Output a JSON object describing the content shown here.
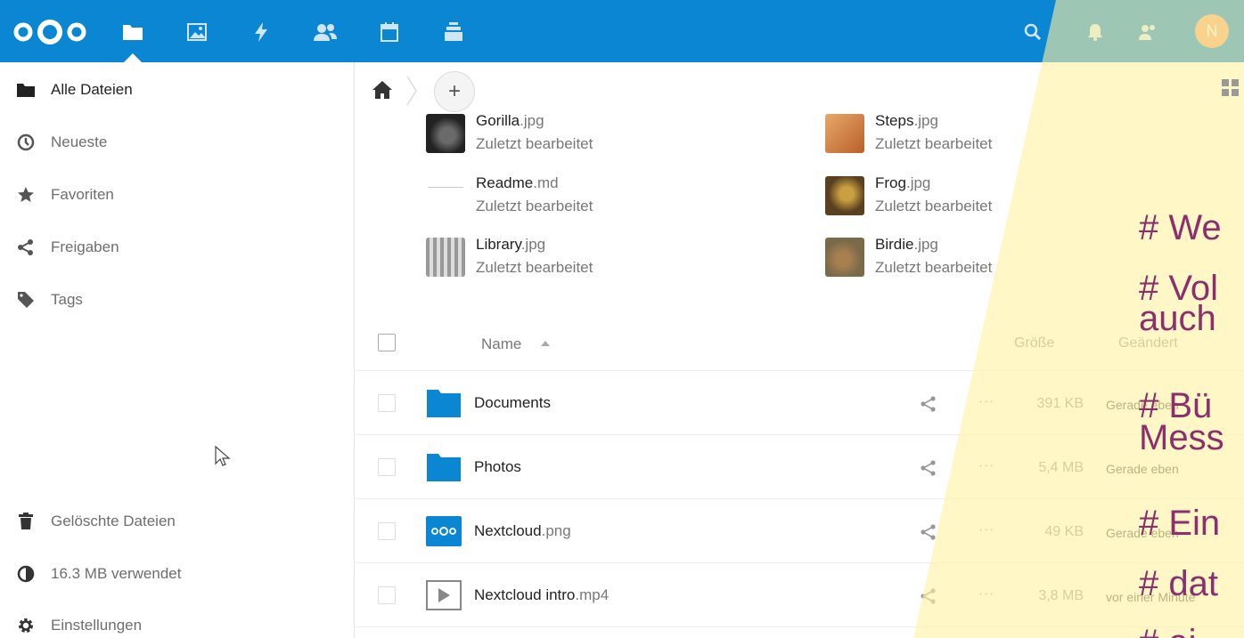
{
  "colors": {
    "header": "#0b86d2",
    "folder": "#0b86d2",
    "overlay": "#fff3a0",
    "overlay_text": "#8b2f6e"
  },
  "header": {
    "nav": [
      {
        "name": "files-icon",
        "active": true
      },
      {
        "name": "gallery-icon"
      },
      {
        "name": "activity-icon"
      },
      {
        "name": "contacts-icon"
      },
      {
        "name": "calendar-icon"
      },
      {
        "name": "deck-icon"
      }
    ],
    "avatar_letter": "N"
  },
  "sidebar": {
    "items": [
      {
        "label": "Alle Dateien",
        "icon": "folder-icon"
      },
      {
        "label": "Neueste",
        "icon": "clock-icon"
      },
      {
        "label": "Favoriten",
        "icon": "star-icon"
      },
      {
        "label": "Freigaben",
        "icon": "share-icon"
      },
      {
        "label": "Tags",
        "icon": "tag-icon"
      }
    ],
    "bottom": [
      {
        "label": "Gelöschte Dateien",
        "icon": "trash-icon"
      },
      {
        "label": "16.3 MB verwendet",
        "icon": "quota-icon"
      },
      {
        "label": "Einstellungen",
        "icon": "gear-icon"
      }
    ]
  },
  "recent": [
    {
      "base": "Gorilla",
      "ext": ".jpg",
      "sub": "Zuletzt bearbeitet"
    },
    {
      "base": "Readme",
      "ext": ".md",
      "sub": "Zuletzt bearbeitet"
    },
    {
      "base": "Library",
      "ext": ".jpg",
      "sub": "Zuletzt bearbeitet"
    },
    {
      "base": "Steps",
      "ext": ".jpg",
      "sub": "Zuletzt bearbeitet"
    },
    {
      "base": "Frog",
      "ext": ".jpg",
      "sub": "Zuletzt bearbeitet"
    },
    {
      "base": "Birdie",
      "ext": ".jpg",
      "sub": "Zuletzt bearbeitet"
    }
  ],
  "list": {
    "col_name": "Name",
    "col_size": "Größe",
    "col_modified": "Geändert",
    "rows": [
      {
        "base": "Documents",
        "ext": "",
        "size": "391 KB",
        "modified": "Gerade eben"
      },
      {
        "base": "Photos",
        "ext": "",
        "size": "5,4 MB",
        "modified": "Gerade eben"
      },
      {
        "base": "Nextcloud",
        "ext": ".png",
        "size": "49 KB",
        "modified": "Gerade eben"
      },
      {
        "base": "Nextcloud intro",
        "ext": ".mp4",
        "size": "3,8 MB",
        "modified": "vor einer Minute"
      }
    ]
  },
  "overlay": {
    "lines": [
      "# We",
      "# Vol",
      "auch",
      "# Bü",
      "Mess",
      "# Ein",
      "# dat",
      "# ai"
    ]
  },
  "add_label": "+"
}
